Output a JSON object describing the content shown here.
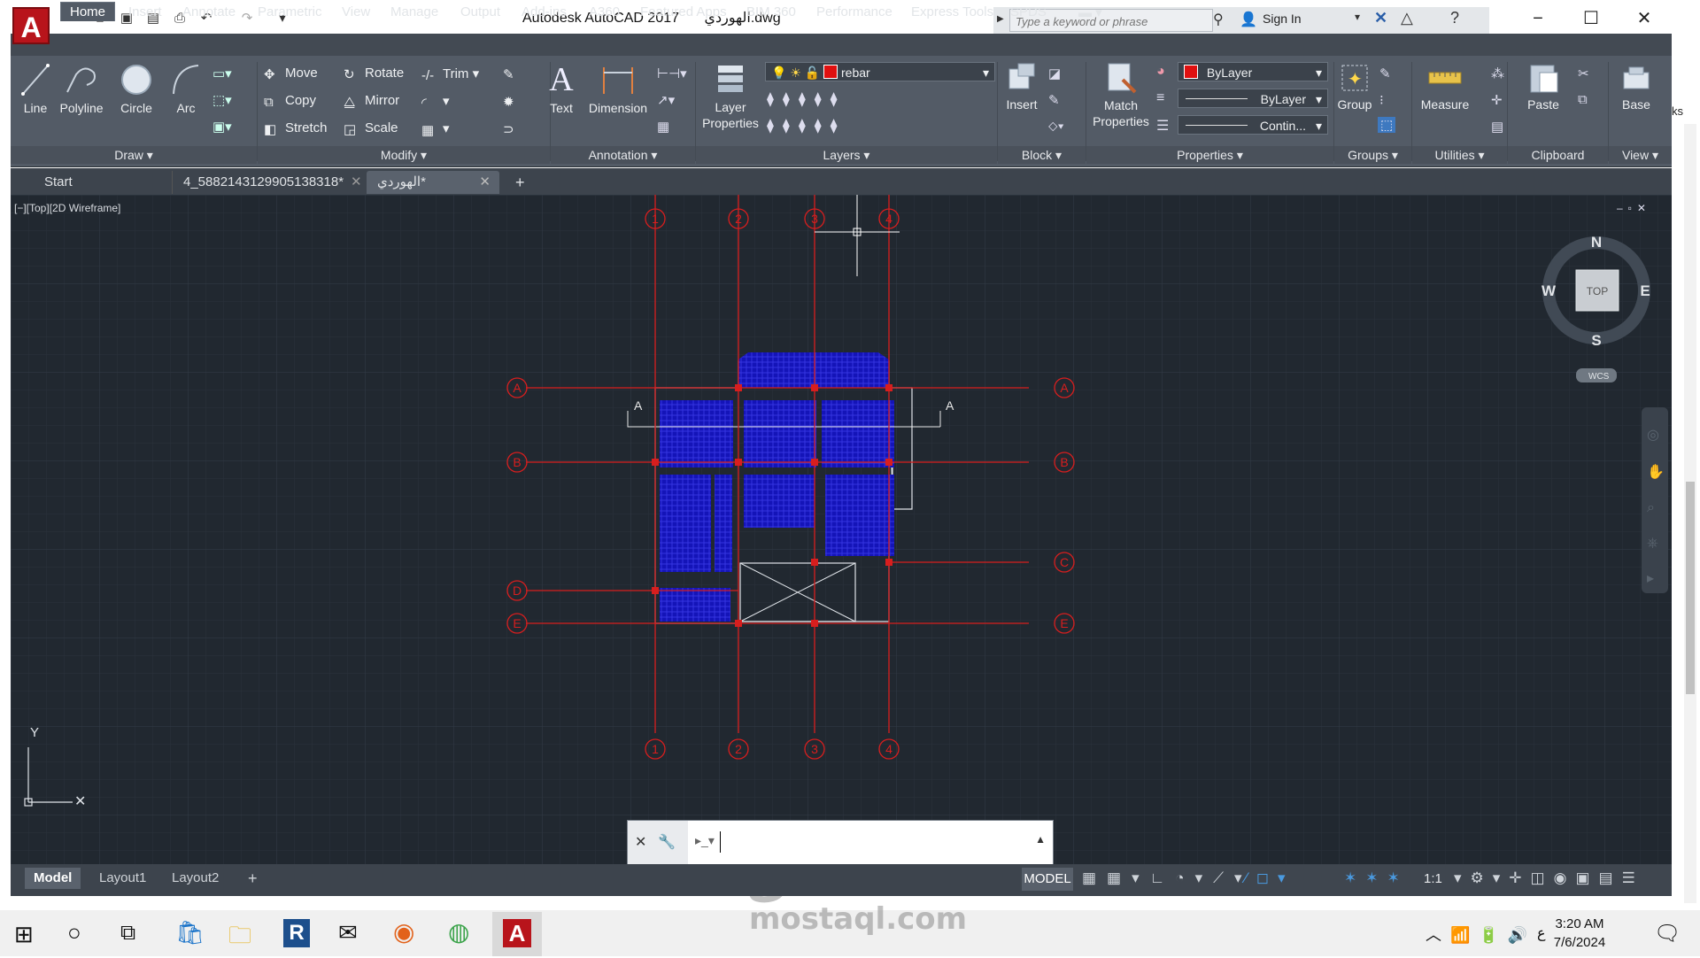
{
  "window": {
    "app_name": "Autodesk AutoCAD 2017",
    "file_name": "الهوردي.dwg",
    "search_placeholder": "Type a keyword or phrase",
    "sign_in": "Sign In",
    "logo_letter": "A"
  },
  "ribbon": {
    "tabs": [
      "Home",
      "Insert",
      "Annotate",
      "Parametric",
      "View",
      "Manage",
      "Output",
      "Add-ins",
      "A360",
      "Featured Apps",
      "BIM 360",
      "Performance",
      "Express Tools",
      "SPDS"
    ],
    "active_tab": "Home",
    "draw": {
      "line": "Line",
      "polyline": "Polyline",
      "circle": "Circle",
      "arc": "Arc",
      "title": "Draw"
    },
    "modify": {
      "move": "Move",
      "rotate": "Rotate",
      "trim": "Trim",
      "copy": "Copy",
      "mirror": "Mirror",
      "stretch": "Stretch",
      "scale": "Scale",
      "title": "Modify"
    },
    "annotation": {
      "text": "Text",
      "dimension": "Dimension",
      "title": "Annotation"
    },
    "layers": {
      "layer_properties": "Layer Properties",
      "current_layer": "rebar",
      "layer_color": "#e01010",
      "title": "Layers"
    },
    "block": {
      "insert": "Insert",
      "title": "Block"
    },
    "properties": {
      "match": "Match Properties",
      "color": "ByLayer",
      "lineweight": "ByLayer",
      "linetype": "Contin...",
      "title": "Properties"
    },
    "groups": {
      "group": "Group",
      "title": "Groups"
    },
    "utilities": {
      "measure": "Measure",
      "title": "Utilities"
    },
    "clipboard": {
      "paste": "Paste",
      "title": "Clipboard"
    },
    "view": {
      "base": "Base",
      "title": "View"
    },
    "overflow_text": "ks"
  },
  "file_tabs": [
    "Start",
    "4_5882143129905138318*",
    "الهوردي*"
  ],
  "viewport": {
    "label": "[−][Top][2D Wireframe]",
    "compass": {
      "n": "N",
      "s": "S",
      "e": "E",
      "w": "W",
      "top": "TOP",
      "wcs": "WCS"
    },
    "ucs_y": "Y",
    "grid_numbers": [
      "1",
      "2",
      "3",
      "4"
    ],
    "grid_letters": [
      "A",
      "B",
      "C",
      "D",
      "E"
    ],
    "section_mark": "A"
  },
  "layout_tabs": [
    "Model",
    "Layout1",
    "Layout2"
  ],
  "status": {
    "model": "MODEL",
    "scale": "1:1"
  },
  "watermark": {
    "arabic": "مستقل",
    "latin": "mostaql.com"
  },
  "taskbar": {
    "time": "3:20 AM",
    "date": "7/6/2024",
    "lang": "ع"
  }
}
